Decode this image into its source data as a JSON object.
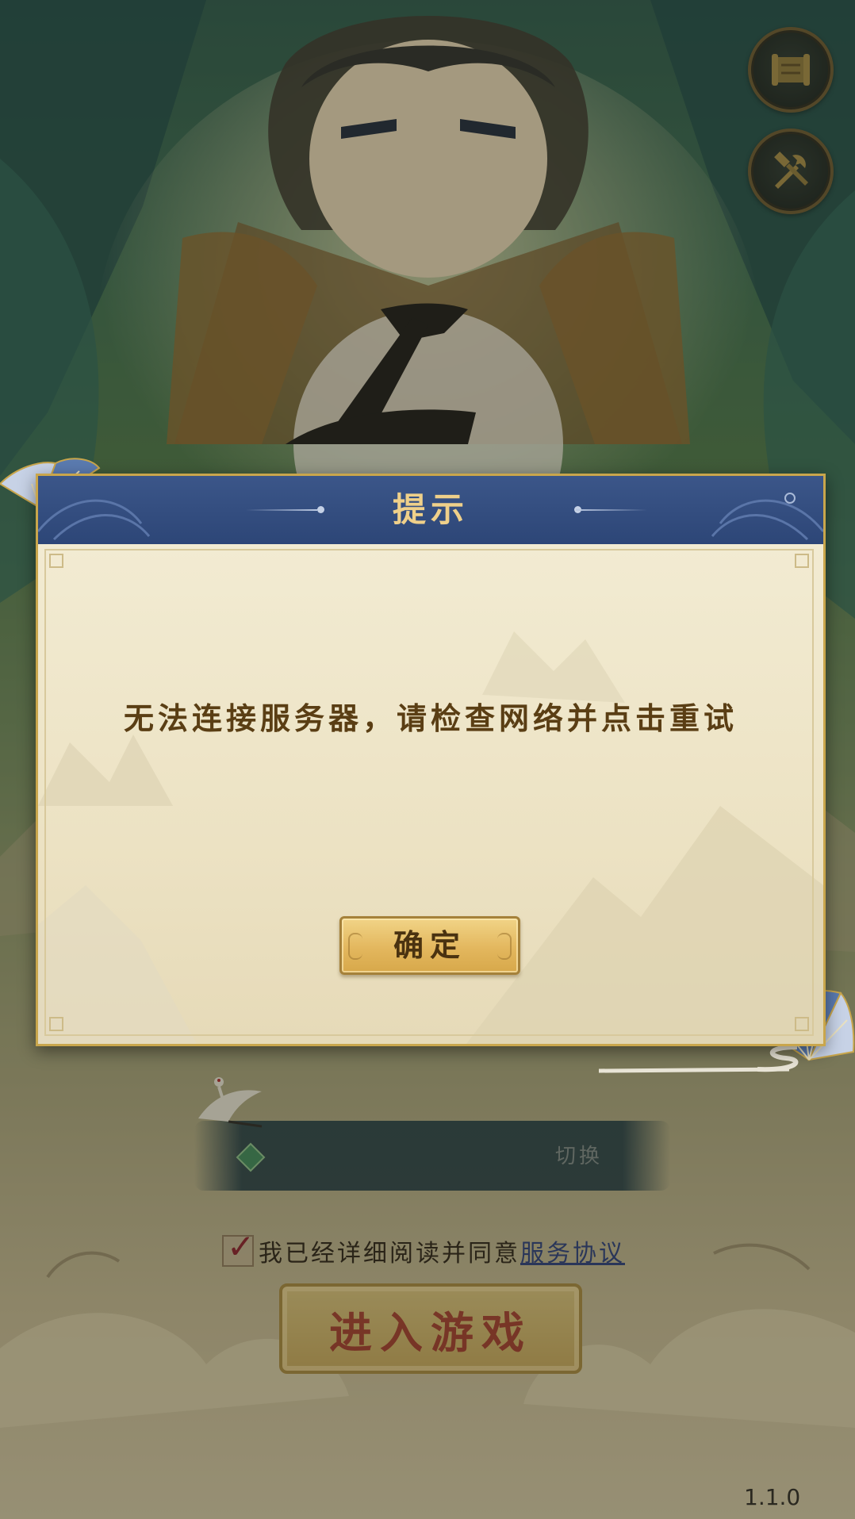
{
  "top_buttons": {
    "scroll_icon": "scroll-icon",
    "tools_icon": "tools-icon"
  },
  "dialog": {
    "title": "提示",
    "message": "无法连接服务器，请检查网络并点击重试",
    "confirm_label": "确定"
  },
  "server_bar": {
    "switch_label": "切换"
  },
  "agreement": {
    "checked": true,
    "text": "我已经详细阅读并同意",
    "link_label": "服务协议"
  },
  "enter_button": {
    "label": "进入游戏"
  },
  "version": "1.1.0",
  "colors": {
    "dialog_header": "#2d4677",
    "dialog_gold": "#c9a64c",
    "dialog_body": "#f2ebd2",
    "message_text": "#5a3e14",
    "enter_text": "#9b2a22",
    "link_blue": "#2b3f7a"
  }
}
